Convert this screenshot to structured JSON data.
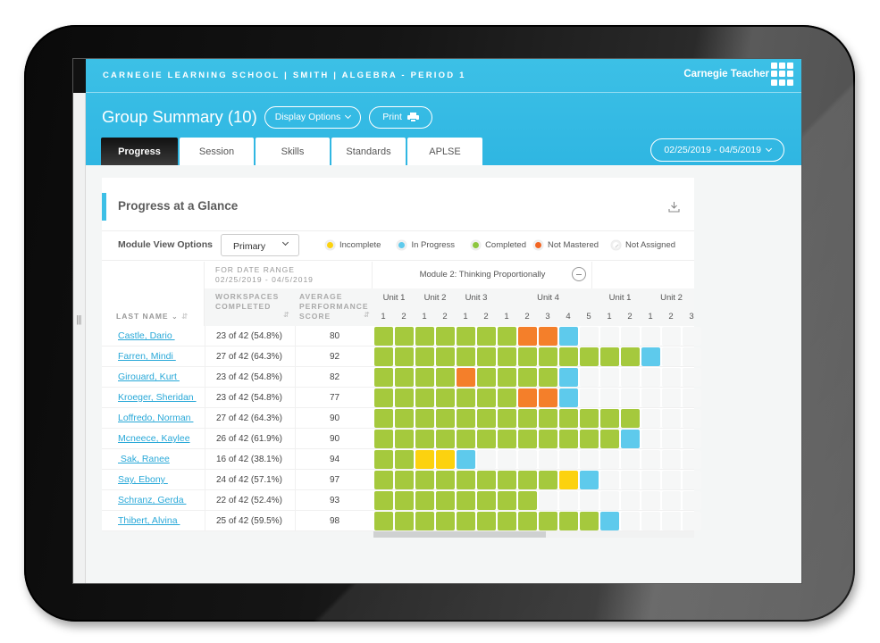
{
  "header": {
    "breadcrumb": "CARNEGIE LEARNING SCHOOL | SMITH | ALGEBRA - PERIOD 1",
    "user_name": "Carnegie Teacher",
    "apps_icon": "grid-apps-icon",
    "page_title": "Group Summary (10)",
    "display_options_label": "Display Options",
    "print_label": "Print",
    "date_range_label": "02/25/2019 - 04/5/2019",
    "tabs": [
      {
        "label": "Progress",
        "active": true
      },
      {
        "label": "Session",
        "active": false
      },
      {
        "label": "Skills",
        "active": false
      },
      {
        "label": "Standards",
        "active": false
      },
      {
        "label": "APLSE",
        "active": false
      }
    ]
  },
  "card": {
    "title": "Progress at a Glance",
    "download_icon": "download-icon",
    "module_view_label": "Module View Options",
    "module_view_selected": "Primary",
    "legend": [
      {
        "key": "incomplete",
        "label": "Incomplete"
      },
      {
        "key": "in_progress",
        "label": "In Progress"
      },
      {
        "key": "completed",
        "label": "Completed"
      },
      {
        "key": "not_mastered",
        "label": "Not Mastered"
      },
      {
        "key": "not_assigned",
        "label": "Not Assigned"
      }
    ],
    "status_colors": {
      "completed": "#a5c93d",
      "not_mastered": "#f47f2a",
      "in_progress": "#5ecaec",
      "incomplete": "#fcd20f",
      "not_assigned": "#f6f7f7"
    }
  },
  "table": {
    "date_range_label": "FOR DATE RANGE",
    "date_range_value": "02/25/2019 - 04/5/2019",
    "module_title": "Module 2: Thinking Proportionally",
    "col_last_name": "LAST NAME",
    "col_workspaces_1": "WORKSPACES",
    "col_workspaces_2": "COMPLETED",
    "col_score_1": "AVERAGE",
    "col_score_2": "PERFORMANCE",
    "col_score_3": "SCORE",
    "units": [
      {
        "label": "Unit 1",
        "lessons": [
          "1",
          "2"
        ]
      },
      {
        "label": "Unit 2",
        "lessons": [
          "1",
          "2"
        ]
      },
      {
        "label": "Unit 3",
        "lessons": [
          "1",
          "2"
        ]
      },
      {
        "label": "Unit 4",
        "lessons": [
          "1",
          "2",
          "3",
          "4",
          "5"
        ]
      },
      {
        "label": "Unit 1",
        "lessons": [
          "1",
          "2"
        ]
      },
      {
        "label": "Unit 2",
        "lessons": [
          "1",
          "2",
          "3"
        ]
      }
    ],
    "students": [
      {
        "name": "Castle, Dario ",
        "workspaces": "23 of 42 (54.8%)",
        "score": "80",
        "progress": [
          "C",
          "C",
          "C",
          "C",
          "C",
          "C",
          "C",
          "M",
          "M",
          "P"
        ]
      },
      {
        "name": "Farren, Mindi ",
        "workspaces": "27 of 42 (64.3%)",
        "score": "92",
        "progress": [
          "C",
          "C",
          "C",
          "C",
          "C",
          "C",
          "C",
          "C",
          "C",
          "C",
          "C",
          "C",
          "C",
          "P"
        ]
      },
      {
        "name": "Girouard, Kurt ",
        "workspaces": "23 of 42 (54.8%)",
        "score": "82",
        "progress": [
          "C",
          "C",
          "C",
          "C",
          "M",
          "C",
          "C",
          "C",
          "C",
          "P"
        ]
      },
      {
        "name": "Kroeger, Sheridan ",
        "workspaces": "23 of 42 (54.8%)",
        "score": "77",
        "progress": [
          "C",
          "C",
          "C",
          "C",
          "C",
          "C",
          "C",
          "M",
          "M",
          "P"
        ]
      },
      {
        "name": "Loffredo, Norman ",
        "workspaces": "27 of 42 (64.3%)",
        "score": "90",
        "progress": [
          "C",
          "C",
          "C",
          "C",
          "C",
          "C",
          "C",
          "C",
          "C",
          "C",
          "C",
          "C",
          "C"
        ]
      },
      {
        "name": "Mcneece, Kaylee",
        "workspaces": "26 of 42 (61.9%)",
        "score": "90",
        "progress": [
          "C",
          "C",
          "C",
          "C",
          "C",
          "C",
          "C",
          "C",
          "C",
          "C",
          "C",
          "C",
          "P"
        ]
      },
      {
        "name": " Sak, Ranee",
        "workspaces": "16 of 42 (38.1%)",
        "score": "94",
        "progress": [
          "C",
          "C",
          "I",
          "I",
          "P"
        ]
      },
      {
        "name": "Say, Ebony ",
        "workspaces": "24 of 42 (57.1%)",
        "score": "97",
        "progress": [
          "C",
          "C",
          "C",
          "C",
          "C",
          "C",
          "C",
          "C",
          "C",
          "I",
          "P"
        ]
      },
      {
        "name": "Schranz, Gerda ",
        "workspaces": "22 of 42 (52.4%)",
        "score": "93",
        "progress": [
          "C",
          "C",
          "C",
          "C",
          "C",
          "C",
          "C",
          "C"
        ]
      },
      {
        "name": "Thibert, Alvina ",
        "workspaces": "25 of 42 (59.5%)",
        "score": "98",
        "progress": [
          "C",
          "C",
          "C",
          "C",
          "C",
          "C",
          "C",
          "C",
          "C",
          "C",
          "C",
          "P"
        ]
      }
    ],
    "status_codes": {
      "C": "completed",
      "M": "not_mastered",
      "P": "in_progress",
      "I": "incomplete"
    }
  }
}
